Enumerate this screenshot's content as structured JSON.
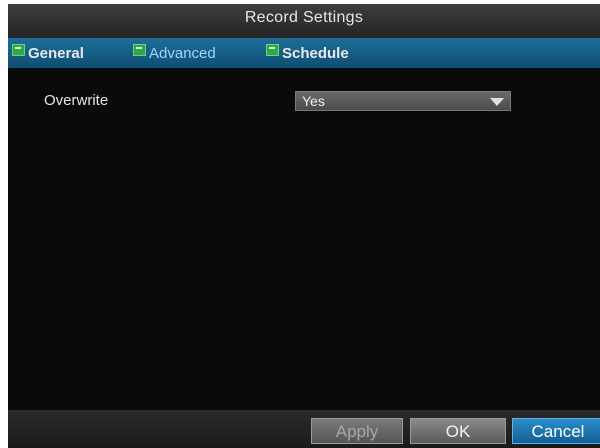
{
  "window": {
    "title": "Record Settings"
  },
  "tabs": [
    {
      "label": "General",
      "active": false,
      "icon": "tab-icon"
    },
    {
      "label": "Advanced",
      "active": true,
      "icon": "tab-icon"
    },
    {
      "label": "Schedule",
      "active": false,
      "icon": "tab-icon"
    }
  ],
  "fields": {
    "overwrite": {
      "label": "Overwrite",
      "value": "Yes"
    }
  },
  "buttons": {
    "apply": "Apply",
    "ok": "OK",
    "cancel": "Cancel"
  },
  "colors": {
    "tab_strip": "#0e4d72",
    "active_tab_text": "#9fd4ff",
    "cancel_button": "#2b8ccc"
  }
}
